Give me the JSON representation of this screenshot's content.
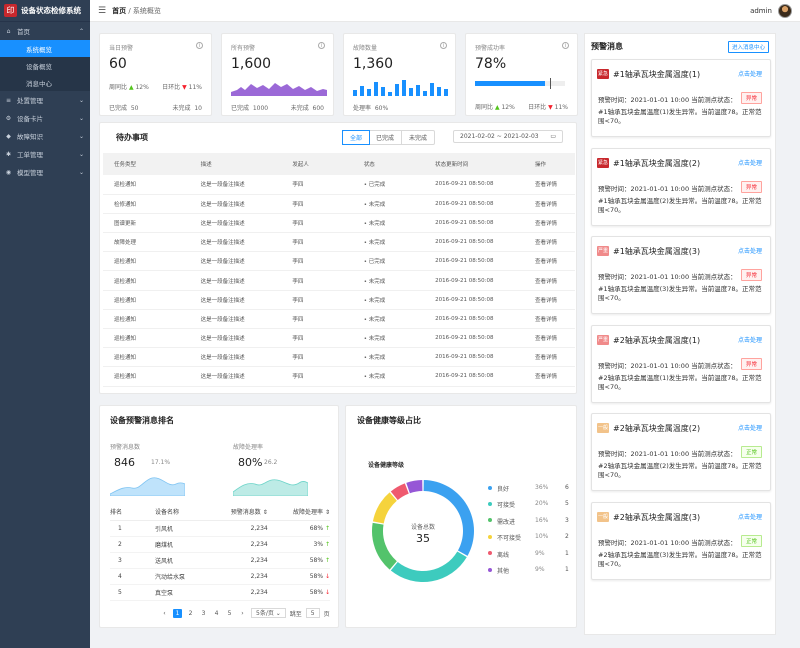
{
  "app": {
    "title": "设备状态检修系统"
  },
  "sidebar": {
    "groups": [
      {
        "label": "首页",
        "icon": "home-icon",
        "expanded": true,
        "children": [
          {
            "label": "系统概览",
            "active": true
          },
          {
            "label": "设备概览",
            "active": false
          },
          {
            "label": "消息中心",
            "active": false
          }
        ]
      },
      {
        "label": "处置管理",
        "icon": "list-icon",
        "expanded": false
      },
      {
        "label": "设备卡片",
        "icon": "gear-icon",
        "expanded": false
      },
      {
        "label": "故障知识",
        "icon": "tag-icon",
        "expanded": false
      },
      {
        "label": "工单管理",
        "icon": "settings-icon",
        "expanded": false
      },
      {
        "label": "模型管理",
        "icon": "cube-icon",
        "expanded": false
      }
    ]
  },
  "header": {
    "breadcrumb_home": "首页",
    "breadcrumb_sep": "/",
    "breadcrumb_current": "系统概览",
    "user": "admin"
  },
  "stats": [
    {
      "title": "当日预警",
      "value": "60",
      "left_label": "周同比",
      "left_val": "12%",
      "right_label": "日环比",
      "right_val": "11%",
      "foot_left": "已完成",
      "foot_left_val": "50",
      "foot_right": "未完成",
      "foot_right_val": "10",
      "chart": "none"
    },
    {
      "title": "所有预警",
      "value": "1,600",
      "foot_left": "已完成",
      "foot_left_val": "1000",
      "foot_right": "未完成",
      "foot_right_val": "600",
      "chart": "area",
      "color": "#8a4fd0"
    },
    {
      "title": "故障数量",
      "value": "1,360",
      "foot_left": "处理率",
      "foot_left_val": "60%",
      "chart": "bar",
      "color": "#1890ff"
    },
    {
      "title": "预警成功率",
      "value": "78%",
      "progress": 0.78,
      "left_label": "周同比",
      "left_val": "12%",
      "right_label": "日环比",
      "right_val": "11%",
      "chart": "progress",
      "color": "#1890ff"
    }
  ],
  "todo": {
    "title": "待办事项",
    "filters": [
      "全部",
      "已完成",
      "未完成"
    ],
    "date_range": "2021-02-02 ~ 2021-02-03",
    "columns": [
      "任务类型",
      "描述",
      "发起人",
      "状态",
      "状态更新时间",
      "操作"
    ],
    "rows": [
      [
        "巡检通知",
        "这是一段备注描述",
        "李四",
        "已完成",
        "2016-09-21  08:50:08",
        "查看详情"
      ],
      [
        "检修通知",
        "这是一段备注描述",
        "李四",
        "未完成",
        "2016-09-21  08:50:08",
        "查看详情"
      ],
      [
        "图谱更新",
        "这是一段备注描述",
        "李四",
        "未完成",
        "2016-09-21  08:50:08",
        "查看详情"
      ],
      [
        "故障处理",
        "这是一段备注描述",
        "李四",
        "未完成",
        "2016-09-21  08:50:08",
        "查看详情"
      ],
      [
        "巡检通知",
        "这是一段备注描述",
        "李四",
        "已完成",
        "2016-09-21  08:50:08",
        "查看详情"
      ],
      [
        "巡检通知",
        "这是一段备注描述",
        "李四",
        "未完成",
        "2016-09-21  08:50:08",
        "查看详情"
      ],
      [
        "巡检通知",
        "这是一段备注描述",
        "李四",
        "未完成",
        "2016-09-21  08:50:08",
        "查看详情"
      ],
      [
        "巡检通知",
        "这是一段备注描述",
        "李四",
        "未完成",
        "2016-09-21  08:50:08",
        "查看详情"
      ],
      [
        "巡检通知",
        "这是一段备注描述",
        "李四",
        "未完成",
        "2016-09-21  08:50:08",
        "查看详情"
      ],
      [
        "巡检通知",
        "这是一段备注描述",
        "李四",
        "未完成",
        "2016-09-21  08:50:08",
        "查看详情"
      ],
      [
        "巡检通知",
        "这是一段备注描述",
        "李四",
        "未完成",
        "2016-09-21  08:50:08",
        "查看详情"
      ]
    ]
  },
  "ranking": {
    "title": "设备预警消息排名",
    "kpi1_label": "预警消息数",
    "kpi1_value": "846",
    "kpi1_rate": "17.1%",
    "kpi2_label": "故障处理率",
    "kpi2_value": "80%",
    "kpi2_rate": "26.2",
    "columns": [
      "排名",
      "设备名称",
      "预警消息数",
      "故障处理率"
    ],
    "rows": [
      {
        "rank": "1",
        "name": "引风机",
        "count": "2,234",
        "rate": "68%",
        "trend": "up"
      },
      {
        "rank": "2",
        "name": "磨煤机",
        "count": "2,234",
        "rate": "3%",
        "trend": "up"
      },
      {
        "rank": "3",
        "name": "送风机",
        "count": "2,234",
        "rate": "58%",
        "trend": "up"
      },
      {
        "rank": "4",
        "name": "汽动给水泵",
        "count": "2,234",
        "rate": "58%",
        "trend": "down"
      },
      {
        "rank": "5",
        "name": "真空泵",
        "count": "2,234",
        "rate": "58%",
        "trend": "down"
      }
    ],
    "pager": {
      "pages": [
        "1",
        "2",
        "3",
        "4",
        "5"
      ],
      "current": "1",
      "size": "5条/页",
      "jump_label": "跳至",
      "jump_value": "5",
      "jump_unit": "页",
      "prev": "‹",
      "next": "›"
    }
  },
  "health": {
    "title": "设备健康等级占比",
    "subtitle": "设备健康等级",
    "center_label": "设备总数",
    "center_value": "35",
    "chart_data": {
      "type": "pie",
      "categories": [
        "良好",
        "可接受",
        "需改进",
        "不可接受",
        "离线",
        "其他"
      ],
      "values": [
        6,
        5,
        3,
        2,
        1,
        1
      ],
      "percents": [
        "36%",
        "20%",
        "16%",
        "10%",
        "9%",
        "9%"
      ],
      "colors": [
        "#3ba1f0",
        "#3dcbbe",
        "#53c36b",
        "#f5d33c",
        "#ef5a6f",
        "#9657d6"
      ]
    }
  },
  "alerts": {
    "title": "预警消息",
    "enter_label": "进入消息中心",
    "items": [
      {
        "tag": "紧急",
        "tag_color": "#c8282d",
        "title": "#1轴承瓦块金属温度(1)",
        "op": "点击处理",
        "time": "预警时间：2021-01-01 10:00",
        "point_label": "当前测点状态：",
        "status": "异常",
        "status_kind": "bad",
        "desc": "#1轴承瓦块金属温度(1)发生异常。当前温度78。正常范围<70。"
      },
      {
        "tag": "紧急",
        "tag_color": "#c8282d",
        "title": "#1轴承瓦块金属温度(2)",
        "op": "点击处理",
        "time": "预警时间：2021-01-01 10:00",
        "point_label": "当前测点状态：",
        "status": "异常",
        "status_kind": "bad",
        "desc": "#1轴承瓦块金属温度(2)发生异常。当前温度78。正常范围<70。"
      },
      {
        "tag": "严重",
        "tag_color": "#f08a8a",
        "title": "#1轴承瓦块金属温度(3)",
        "op": "点击处理",
        "time": "预警时间：2021-01-01 10:00",
        "point_label": "当前测点状态：",
        "status": "异常",
        "status_kind": "bad",
        "desc": "#1轴承瓦块金属温度(3)发生异常。当前温度78。正常范围<70。"
      },
      {
        "tag": "严重",
        "tag_color": "#f08a8a",
        "title": "#2轴承瓦块金属温度(1)",
        "op": "点击处理",
        "time": "预警时间：2021-01-01 10:00",
        "point_label": "当前测点状态：",
        "status": "异常",
        "status_kind": "bad",
        "desc": "#2轴承瓦块金属温度(1)发生异常。当前温度78。正常范围<70。"
      },
      {
        "tag": "一般",
        "tag_color": "#f2c38a",
        "title": "#2轴承瓦块金属温度(2)",
        "op": "点击处理",
        "time": "预警时间：2021-01-01 10:00",
        "point_label": "当前测点状态：",
        "status": "正常",
        "status_kind": "ok",
        "desc": "#2轴承瓦块金属温度(2)发生异常。当前温度78。正常范围<70。"
      },
      {
        "tag": "一般",
        "tag_color": "#f2c38a",
        "title": "#2轴承瓦块金属温度(3)",
        "op": "点击处理",
        "time": "预警时间：2021-01-01 10:00",
        "point_label": "当前测点状态：",
        "status": "正常",
        "status_kind": "ok",
        "desc": "#2轴承瓦块金属温度(3)发生异常。当前温度78。正常范围<70。"
      }
    ]
  }
}
